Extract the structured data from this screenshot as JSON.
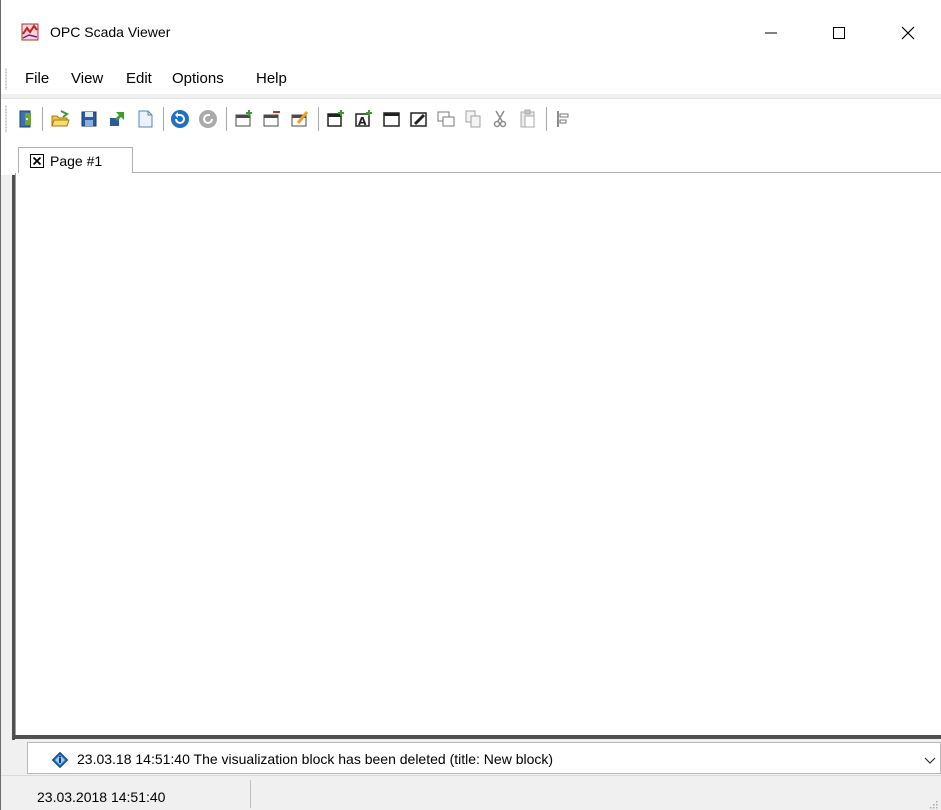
{
  "window": {
    "title": "OPC Scada Viewer",
    "icon": "app-logo-icon"
  },
  "caption_buttons": [
    "minimize-icon",
    "maximize-icon",
    "close-icon"
  ],
  "menu": {
    "items": [
      "File",
      "View",
      "Edit",
      "Options",
      "Help"
    ]
  },
  "toolbar": {
    "buttons": [
      "exit-icon",
      "open-icon",
      "save-icon",
      "export-icon",
      "new-document-icon",
      "undo-icon",
      "redo-icon",
      "add-page-icon",
      "delete-page-icon",
      "edit-page-icon",
      "add-block-icon",
      "add-text-block-icon",
      "block-frame-icon",
      "edit-block-icon",
      "duplicate-icon",
      "copy-icon",
      "cut-icon",
      "paste-icon",
      "align-icon"
    ]
  },
  "tabs": [
    {
      "label": "Page #1",
      "close_icon": "close-tab-icon"
    }
  ],
  "message_bar": {
    "text": "23.03.18 14:51:40 The visualization block has been deleted (title: New block)",
    "icon": "info-diamond-icon"
  },
  "status_bar": {
    "datetime": "23.03.2018 14:51:40"
  },
  "colors": {
    "frame_dark": "#505050",
    "icon_blue": "#1f6fc5",
    "icon_green": "#3c9a2e",
    "icon_orange": "#f0a020"
  }
}
